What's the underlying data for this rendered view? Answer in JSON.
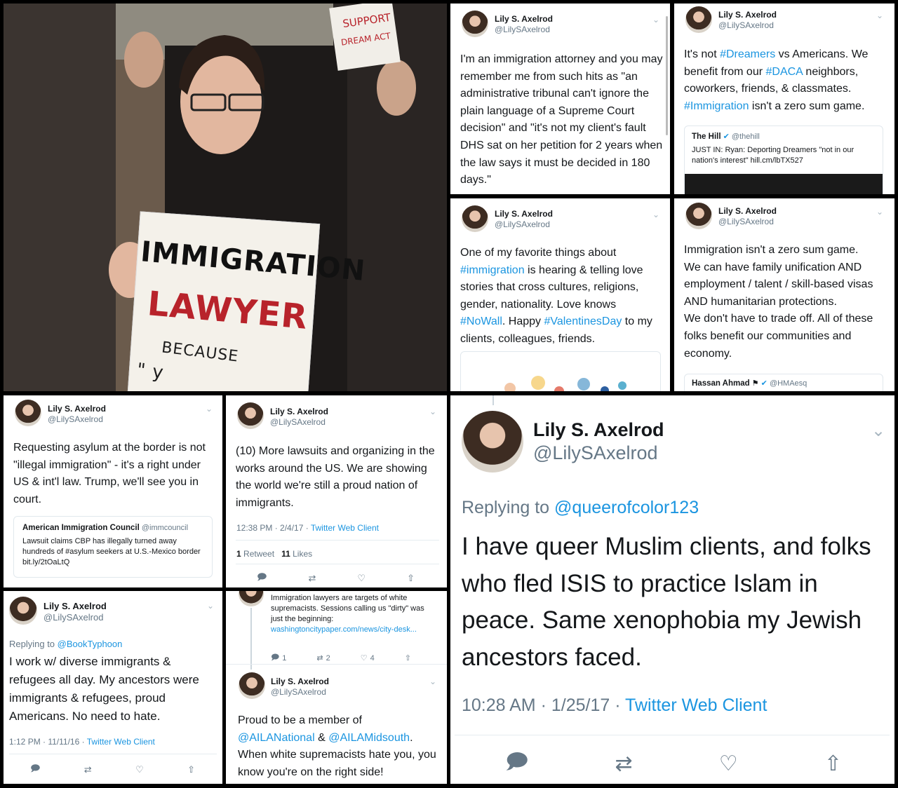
{
  "colors": {
    "link": "#1b95e0",
    "text": "#14171a",
    "muted": "#657786"
  },
  "photo": {
    "sign_line1": "IMMIGRATION",
    "sign_line2": "LAWYER",
    "sign_line3": "BECAUSE",
    "sign_line4": "\" y",
    "bg_sign_line1": "SUPPORT",
    "bg_sign_line2": "DREAM ACT"
  },
  "t1": {
    "name": "Lily S. Axelrod",
    "handle": "@LilySAxelrod",
    "text": "I'm an immigration attorney and you may remember me from such hits as \"an administrative tribunal can't ignore the plain language of a Supreme Court decision\" and \"it's not my client's fault DHS sat on her petition for 2 years when the law says it must be decided in 180 days.\""
  },
  "t2": {
    "name": "Lily S. Axelrod",
    "handle": "@LilySAxelrod",
    "p1": "It's not ",
    "h1": "#Dreamers",
    "p2": " vs Americans. We benefit from our ",
    "h2": "#DACA",
    "p3": " neighbors, coworkers, friends, & classmates. ",
    "h3": "#Immigration",
    "p4": " isn't a zero sum game.",
    "quote_name": "The Hill",
    "quote_handle": "@thehill",
    "quote_text": "JUST IN: Ryan: Deporting Dreamers \"not in our nation's interest\" hill.cm/lbTX527"
  },
  "t3": {
    "name": "Lily S. Axelrod",
    "handle": "@LilySAxelrod",
    "p1": "One of my favorite things about ",
    "h1": "#immigration",
    "p2": " is hearing & telling love stories that cross cultures, religions, gender, nationality. Love knows ",
    "h2": "#NoWall",
    "p3": ". Happy ",
    "h3": "#ValentinesDay",
    "p4": " to my clients, colleagues, friends."
  },
  "t4": {
    "name": "Lily S. Axelrod",
    "handle": "@LilySAxelrod",
    "line1": "Immigration isn't a zero sum game.",
    "line2": "We can have family unification AND employment / talent / skill-based visas AND humanitarian protections.",
    "line3": "We don't have to trade off. All of these folks benefit our communities and economy.",
    "quote_name": "Hassan Ahmad",
    "quote_handle": "@HMAesq"
  },
  "t5": {
    "name": "Lily S. Axelrod",
    "handle": "@LilySAxelrod",
    "text": "Requesting asylum at the border is not \"illegal immigration\" - it's a right under US & int'l law. Trump, we'll see you in court.",
    "quote_name": "American Immigration Council",
    "quote_handle": "@immcouncil",
    "quote_text": "Lawsuit claims CBP has illegally turned away hundreds of #asylum seekers at U.S.-Mexico border bit.ly/2tOaLtQ"
  },
  "t6": {
    "name": "Lily S. Axelrod",
    "handle": "@LilySAxelrod",
    "text": "(10) More lawsuits and organizing in the works around the US. We are showing the world we're still a proud nation of immigrants.",
    "time": "12:38 PM · 2/4/17 · ",
    "client": "Twitter Web Client",
    "retweets": "1",
    "retweets_label": "Retweet",
    "likes": "11",
    "likes_label": "Likes"
  },
  "t7": {
    "name": "Lily S. Axelrod",
    "handle": "@LilySAxelrod",
    "replying": "Replying to ",
    "reply_to": "@BookTyphoon",
    "text": "I work w/ diverse immigrants & refugees all day. My ancestors were immigrants & refugees, proud Americans. No need to hate.",
    "time": "1:12 PM · 11/11/16 · ",
    "client": "Twitter Web Client"
  },
  "t8": {
    "prev_text": "Immigration lawyers are targets of white supremacists. Sessions calling us \"dirty\" was just the beginning:",
    "prev_link": "washingtoncitypaper.com/news/city-desk...",
    "prev_replies": "1",
    "prev_retweets": "2",
    "prev_likes": "4",
    "name": "Lily S. Axelrod",
    "handle": "@LilySAxelrod",
    "p1": "Proud to be a member of ",
    "m1": "@AILANational",
    "p2": " & ",
    "m2": "@AILAMidsouth",
    "p3": ". When white supremacists hate you, you know you're on the right side!"
  },
  "t9": {
    "name": "Lily S. Axelrod",
    "handle": "@LilySAxelrod",
    "replying": "Replying to ",
    "reply_to": "@queerofcolor123",
    "text": "I have queer Muslim clients, and folks who fled ISIS to practice Islam in peace. Same xenophobia my Jewish ancestors faced.",
    "time": "10:28 AM · 1/25/17 · ",
    "client": "Twitter Web Client"
  },
  "icons": {
    "reply": "reply-icon",
    "retweet": "retweet-icon",
    "like": "heart-icon",
    "share": "share-icon",
    "chevron": "chevron-down-icon",
    "verified": "verified-icon"
  }
}
